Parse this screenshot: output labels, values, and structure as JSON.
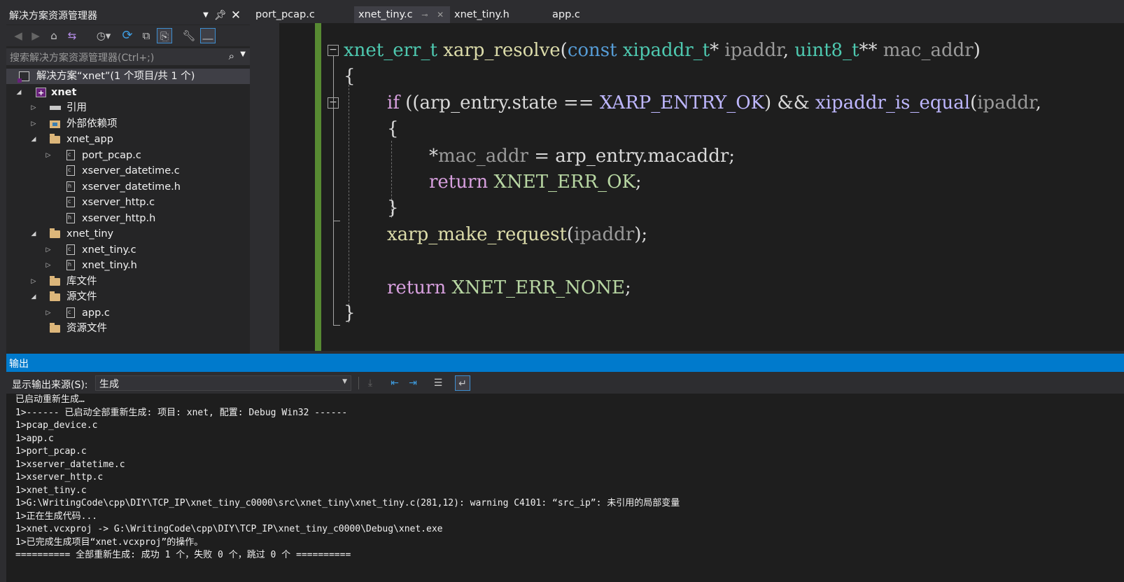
{
  "solution_explorer": {
    "title": "解决方案资源管理器",
    "search_placeholder": "搜索解决方案资源管理器(Ctrl+;)",
    "tree": {
      "solution": "解决方案“xnet”(1 个项目/共 1 个)",
      "project": "xnet",
      "references": "引用",
      "external_deps": "外部依赖项",
      "xnet_app": "xnet_app",
      "port_pcap_c": "port_pcap.c",
      "xserver_datetime_c": "xserver_datetime.c",
      "xserver_datetime_h": "xserver_datetime.h",
      "xserver_http_c": "xserver_http.c",
      "xserver_http_h": "xserver_http.h",
      "xnet_tiny": "xnet_tiny",
      "xnet_tiny_c": "xnet_tiny.c",
      "xnet_tiny_h": "xnet_tiny.h",
      "lib_files": "库文件",
      "source_files": "源文件",
      "app_c": "app.c",
      "resource_files": "资源文件"
    }
  },
  "tabs": [
    "port_pcap.c",
    "xnet_tiny.c",
    "xnet_tiny.h",
    "app.c"
  ],
  "active_tab": "xnet_tiny.c",
  "code": {
    "l1": {
      "ret_type": "xnet_err_t",
      "func": "xarp_resolve",
      "open": "(",
      "kw_const": "const",
      "t1": "xipaddr_t",
      "ptr1": "*",
      "p1": "ipaddr",
      "comma": ",",
      "t2": "uint8_t",
      "ptr2": "**",
      "p2": "mac_addr",
      "close": ")"
    },
    "l2": "{",
    "l3": {
      "kw_if": "if",
      "a": "((arp_entry.state == ",
      "mac": "XARP_ENTRY_OK",
      "b": ") && ",
      "fn": "xipaddr_is_equal",
      "c": "(",
      "p": "ipaddr",
      "d": ","
    },
    "l4": "{",
    "l5": {
      "star": "*",
      "p": "mac_addr",
      "rest": " = arp_entry.macaddr;"
    },
    "l6": {
      "kw": "return",
      "en": "XNET_ERR_OK",
      "semi": ";"
    },
    "l7": "}",
    "l8": {
      "fn": "xarp_make_request",
      "open": "(",
      "p": "ipaddr",
      "close": ");"
    },
    "l10": {
      "kw": "return",
      "en": "XNET_ERR_NONE",
      "semi": ";"
    },
    "l11": "}"
  },
  "output": {
    "title": "输出",
    "source_label": "显示输出来源(S):",
    "source_value": "生成",
    "lines": [
      "已启动重新生成…",
      "1>------ 已启动全部重新生成: 项目: xnet, 配置: Debug Win32 ------",
      "1>pcap_device.c",
      "1>app.c",
      "1>port_pcap.c",
      "1>xserver_datetime.c",
      "1>xserver_http.c",
      "1>xnet_tiny.c",
      "1>G:\\WritingCode\\cpp\\DIY\\TCP_IP\\xnet_tiny_c0000\\src\\xnet_tiny\\xnet_tiny.c(281,12): warning C4101: “src_ip”: 未引用的局部变量",
      "1>正在生成代码...",
      "1>xnet.vcxproj -> G:\\WritingCode\\cpp\\DIY\\TCP_IP\\xnet_tiny_c0000\\Debug\\xnet.exe",
      "1>已完成生成项目“xnet.vcxproj”的操作。",
      "========== 全部重新生成: 成功 1 个，失败 0 个，跳过 0 个 =========="
    ]
  },
  "icons": {
    "se_title_buttons": [
      "dropdown-icon",
      "pin-icon",
      "close-icon"
    ],
    "se_toolbar": [
      "back-icon",
      "forward-icon",
      "home-icon",
      "switch-views-icon",
      "pending-changes-icon",
      "sync-icon",
      "collapse-all-icon",
      "show-all-files-icon",
      "properties-icon",
      "preview-icon"
    ],
    "output_toolbar": [
      "go-to-message-icon",
      "previous-message-icon",
      "next-message-icon",
      "clear-all-icon",
      "word-wrap-icon"
    ]
  },
  "colors": {
    "accent": "#007acc",
    "keyword": "#569cd6",
    "type": "#4ec9b0",
    "function": "#dcdcaa",
    "control": "#d8a0df",
    "macro": "#beb7ff",
    "enum": "#b8d7a3",
    "parameter": "#9a9a9a",
    "change_bar": "#578a32"
  }
}
